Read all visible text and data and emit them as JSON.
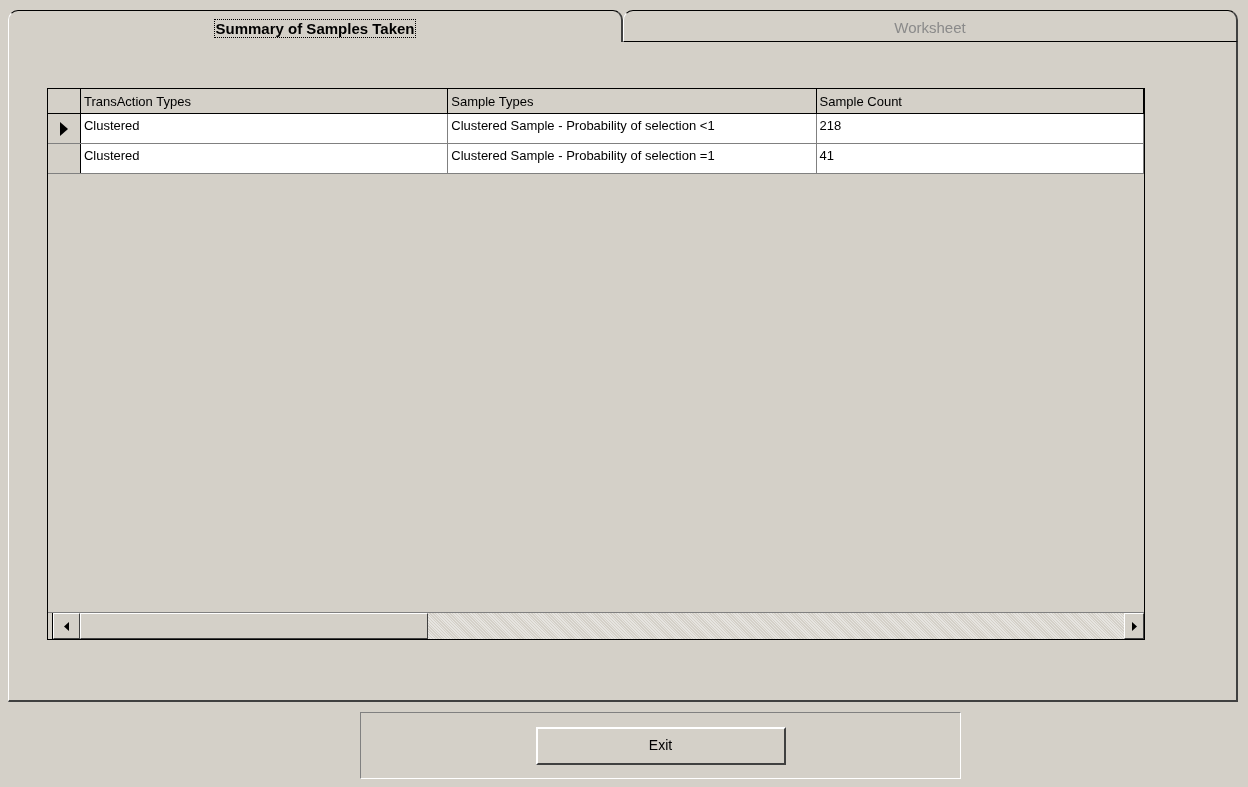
{
  "tabs": [
    {
      "label": "Summary of Samples Taken",
      "selected": true
    },
    {
      "label": "Worksheet",
      "selected": false
    }
  ],
  "grid": {
    "columns": [
      "TransAction Types",
      "Sample Types",
      "Sample Count"
    ],
    "rows": [
      {
        "selected": true,
        "cells": [
          "Clustered",
          "Clustered Sample - Probability of selection <1",
          "218"
        ]
      },
      {
        "selected": false,
        "cells": [
          "Clustered",
          "Clustered Sample - Probability of selection =1",
          "41"
        ]
      }
    ]
  },
  "buttons": [
    "Exit"
  ]
}
